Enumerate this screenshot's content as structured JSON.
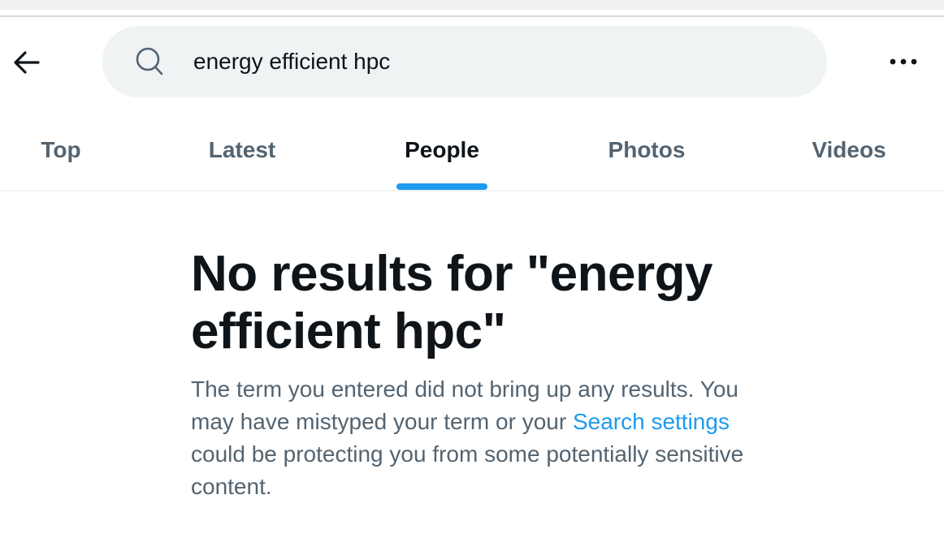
{
  "header": {
    "back_icon": "arrow-left-icon",
    "more_icon": "more-horizontal-icon"
  },
  "search": {
    "icon": "search-icon",
    "value": "energy efficient hpc"
  },
  "tabs": [
    {
      "label": "Top",
      "active": false
    },
    {
      "label": "Latest",
      "active": false
    },
    {
      "label": "People",
      "active": true
    },
    {
      "label": "Photos",
      "active": false
    },
    {
      "label": "Videos",
      "active": false
    }
  ],
  "empty_state": {
    "title": "No results for \"energy efficient hpc\"",
    "text_before_link": "The term you entered did not bring up any results. You may have mistyped your term or your ",
    "link_label": "Search settings",
    "text_after_link": " could be protecting you from some potentially sensitive content."
  },
  "colors": {
    "accent": "#1d9bf0",
    "primary_text": "#0f1419",
    "secondary_text": "#536471",
    "search_bg": "#eff3f4"
  }
}
